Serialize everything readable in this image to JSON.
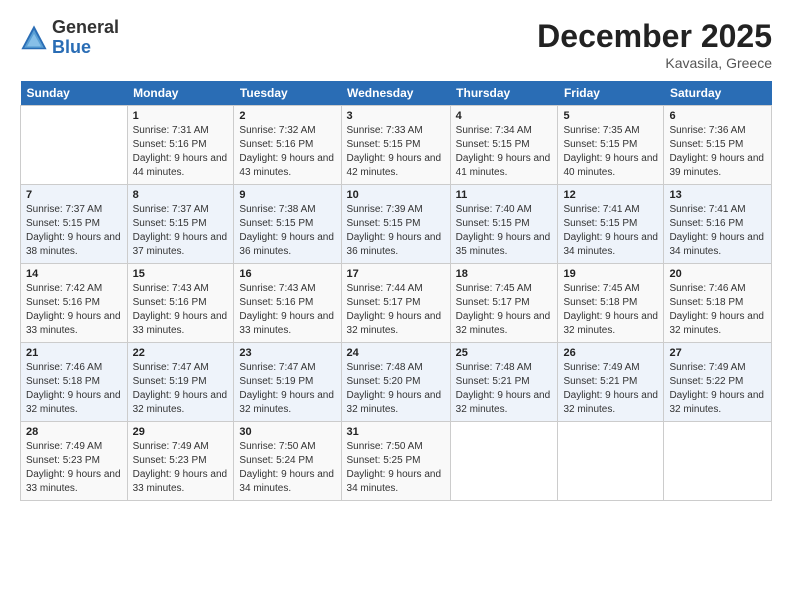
{
  "logo": {
    "general": "General",
    "blue": "Blue"
  },
  "header": {
    "month": "December 2025",
    "location": "Kavasila, Greece"
  },
  "weekdays": [
    "Sunday",
    "Monday",
    "Tuesday",
    "Wednesday",
    "Thursday",
    "Friday",
    "Saturday"
  ],
  "weeks": [
    [
      {
        "day": "",
        "sunrise": "",
        "sunset": "",
        "daylight": ""
      },
      {
        "day": "1",
        "sunrise": "Sunrise: 7:31 AM",
        "sunset": "Sunset: 5:16 PM",
        "daylight": "Daylight: 9 hours and 44 minutes."
      },
      {
        "day": "2",
        "sunrise": "Sunrise: 7:32 AM",
        "sunset": "Sunset: 5:16 PM",
        "daylight": "Daylight: 9 hours and 43 minutes."
      },
      {
        "day": "3",
        "sunrise": "Sunrise: 7:33 AM",
        "sunset": "Sunset: 5:15 PM",
        "daylight": "Daylight: 9 hours and 42 minutes."
      },
      {
        "day": "4",
        "sunrise": "Sunrise: 7:34 AM",
        "sunset": "Sunset: 5:15 PM",
        "daylight": "Daylight: 9 hours and 41 minutes."
      },
      {
        "day": "5",
        "sunrise": "Sunrise: 7:35 AM",
        "sunset": "Sunset: 5:15 PM",
        "daylight": "Daylight: 9 hours and 40 minutes."
      },
      {
        "day": "6",
        "sunrise": "Sunrise: 7:36 AM",
        "sunset": "Sunset: 5:15 PM",
        "daylight": "Daylight: 9 hours and 39 minutes."
      }
    ],
    [
      {
        "day": "7",
        "sunrise": "Sunrise: 7:37 AM",
        "sunset": "Sunset: 5:15 PM",
        "daylight": "Daylight: 9 hours and 38 minutes."
      },
      {
        "day": "8",
        "sunrise": "Sunrise: 7:37 AM",
        "sunset": "Sunset: 5:15 PM",
        "daylight": "Daylight: 9 hours and 37 minutes."
      },
      {
        "day": "9",
        "sunrise": "Sunrise: 7:38 AM",
        "sunset": "Sunset: 5:15 PM",
        "daylight": "Daylight: 9 hours and 36 minutes."
      },
      {
        "day": "10",
        "sunrise": "Sunrise: 7:39 AM",
        "sunset": "Sunset: 5:15 PM",
        "daylight": "Daylight: 9 hours and 36 minutes."
      },
      {
        "day": "11",
        "sunrise": "Sunrise: 7:40 AM",
        "sunset": "Sunset: 5:15 PM",
        "daylight": "Daylight: 9 hours and 35 minutes."
      },
      {
        "day": "12",
        "sunrise": "Sunrise: 7:41 AM",
        "sunset": "Sunset: 5:15 PM",
        "daylight": "Daylight: 9 hours and 34 minutes."
      },
      {
        "day": "13",
        "sunrise": "Sunrise: 7:41 AM",
        "sunset": "Sunset: 5:16 PM",
        "daylight": "Daylight: 9 hours and 34 minutes."
      }
    ],
    [
      {
        "day": "14",
        "sunrise": "Sunrise: 7:42 AM",
        "sunset": "Sunset: 5:16 PM",
        "daylight": "Daylight: 9 hours and 33 minutes."
      },
      {
        "day": "15",
        "sunrise": "Sunrise: 7:43 AM",
        "sunset": "Sunset: 5:16 PM",
        "daylight": "Daylight: 9 hours and 33 minutes."
      },
      {
        "day": "16",
        "sunrise": "Sunrise: 7:43 AM",
        "sunset": "Sunset: 5:16 PM",
        "daylight": "Daylight: 9 hours and 33 minutes."
      },
      {
        "day": "17",
        "sunrise": "Sunrise: 7:44 AM",
        "sunset": "Sunset: 5:17 PM",
        "daylight": "Daylight: 9 hours and 32 minutes."
      },
      {
        "day": "18",
        "sunrise": "Sunrise: 7:45 AM",
        "sunset": "Sunset: 5:17 PM",
        "daylight": "Daylight: 9 hours and 32 minutes."
      },
      {
        "day": "19",
        "sunrise": "Sunrise: 7:45 AM",
        "sunset": "Sunset: 5:18 PM",
        "daylight": "Daylight: 9 hours and 32 minutes."
      },
      {
        "day": "20",
        "sunrise": "Sunrise: 7:46 AM",
        "sunset": "Sunset: 5:18 PM",
        "daylight": "Daylight: 9 hours and 32 minutes."
      }
    ],
    [
      {
        "day": "21",
        "sunrise": "Sunrise: 7:46 AM",
        "sunset": "Sunset: 5:18 PM",
        "daylight": "Daylight: 9 hours and 32 minutes."
      },
      {
        "day": "22",
        "sunrise": "Sunrise: 7:47 AM",
        "sunset": "Sunset: 5:19 PM",
        "daylight": "Daylight: 9 hours and 32 minutes."
      },
      {
        "day": "23",
        "sunrise": "Sunrise: 7:47 AM",
        "sunset": "Sunset: 5:19 PM",
        "daylight": "Daylight: 9 hours and 32 minutes."
      },
      {
        "day": "24",
        "sunrise": "Sunrise: 7:48 AM",
        "sunset": "Sunset: 5:20 PM",
        "daylight": "Daylight: 9 hours and 32 minutes."
      },
      {
        "day": "25",
        "sunrise": "Sunrise: 7:48 AM",
        "sunset": "Sunset: 5:21 PM",
        "daylight": "Daylight: 9 hours and 32 minutes."
      },
      {
        "day": "26",
        "sunrise": "Sunrise: 7:49 AM",
        "sunset": "Sunset: 5:21 PM",
        "daylight": "Daylight: 9 hours and 32 minutes."
      },
      {
        "day": "27",
        "sunrise": "Sunrise: 7:49 AM",
        "sunset": "Sunset: 5:22 PM",
        "daylight": "Daylight: 9 hours and 32 minutes."
      }
    ],
    [
      {
        "day": "28",
        "sunrise": "Sunrise: 7:49 AM",
        "sunset": "Sunset: 5:23 PM",
        "daylight": "Daylight: 9 hours and 33 minutes."
      },
      {
        "day": "29",
        "sunrise": "Sunrise: 7:49 AM",
        "sunset": "Sunset: 5:23 PM",
        "daylight": "Daylight: 9 hours and 33 minutes."
      },
      {
        "day": "30",
        "sunrise": "Sunrise: 7:50 AM",
        "sunset": "Sunset: 5:24 PM",
        "daylight": "Daylight: 9 hours and 34 minutes."
      },
      {
        "day": "31",
        "sunrise": "Sunrise: 7:50 AM",
        "sunset": "Sunset: 5:25 PM",
        "daylight": "Daylight: 9 hours and 34 minutes."
      },
      {
        "day": "",
        "sunrise": "",
        "sunset": "",
        "daylight": ""
      },
      {
        "day": "",
        "sunrise": "",
        "sunset": "",
        "daylight": ""
      },
      {
        "day": "",
        "sunrise": "",
        "sunset": "",
        "daylight": ""
      }
    ]
  ]
}
